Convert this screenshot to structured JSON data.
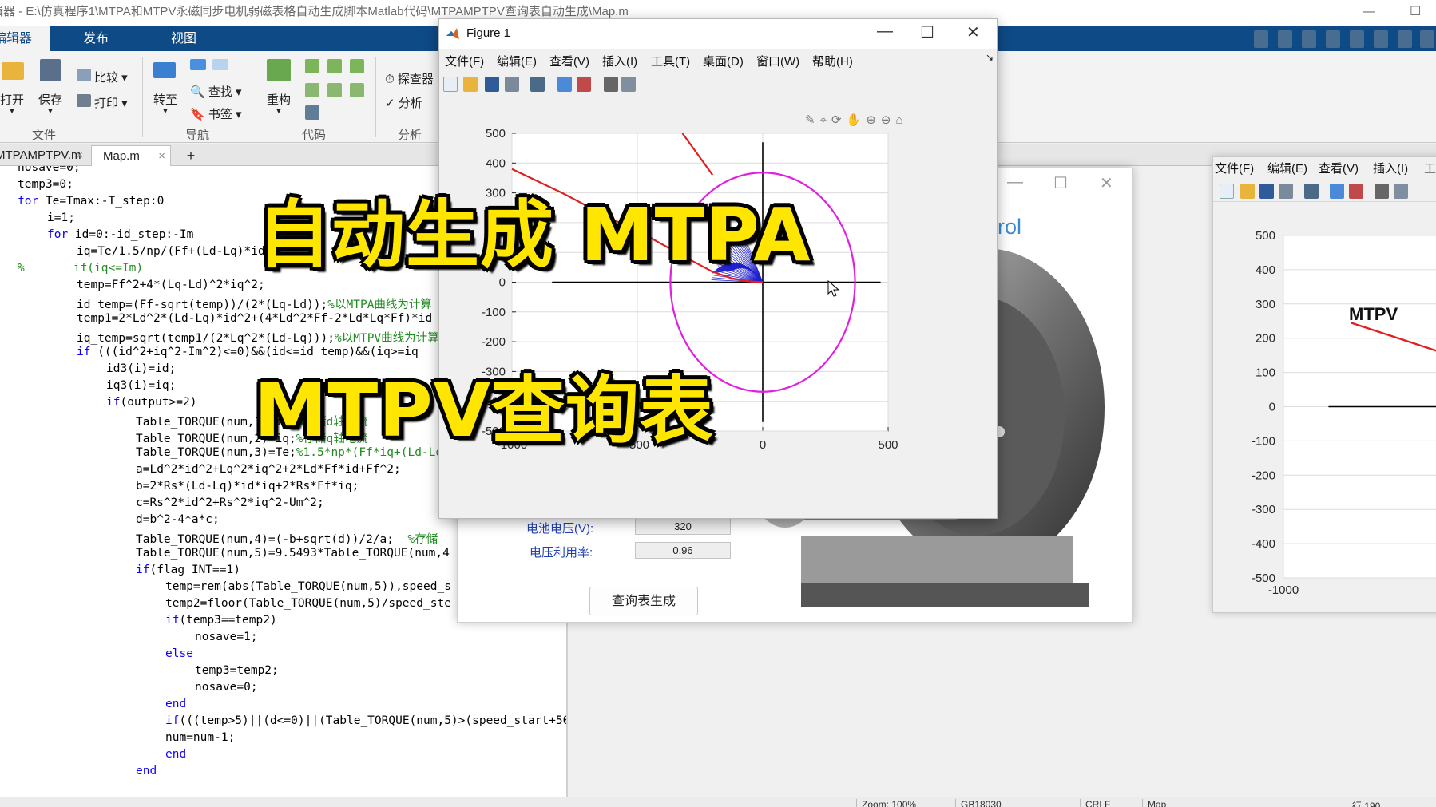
{
  "window_title": "编辑器 - E:\\仿真程序1\\MTPA和MTPV永磁同步电机弱磁表格自动生成脚本Matlab代码\\MTPAMPTPV查询表自动生成\\Map.m",
  "ribbon": {
    "tabs": [
      "编辑器",
      "发布",
      "视图"
    ],
    "file_group": {
      "open": "打开",
      "save": "保存",
      "label": "文件"
    },
    "nav_group": {
      "compare": "比较",
      "print": "打印",
      "goto": "转至",
      "find": "查找",
      "bookmark": "书签",
      "label": "导航"
    },
    "code_group": {
      "refactor": "重构",
      "label": "代码"
    },
    "analyze_group": {
      "explorer": "探查器",
      "analyze": "分析",
      "label": "分析"
    }
  },
  "editor_tabs": [
    "MTPAMPTPV.m",
    "Map.m"
  ],
  "add_tab": "+",
  "code_lines": [
    {
      "indent": 0,
      "parts": [
        {
          "t": "nosave=0;",
          "c": ""
        }
      ]
    },
    {
      "indent": 0,
      "parts": [
        {
          "t": "temp3=0;",
          "c": ""
        }
      ]
    },
    {
      "indent": 0,
      "parts": [
        {
          "t": "for",
          "c": "kw"
        },
        {
          "t": " Te=Tmax:-T_step:0",
          "c": ""
        }
      ]
    },
    {
      "indent": 1,
      "parts": [
        {
          "t": "i=1;",
          "c": ""
        }
      ]
    },
    {
      "indent": 1,
      "parts": [
        {
          "t": "for",
          "c": "kw"
        },
        {
          "t": " id=0:-id_step:-Im",
          "c": ""
        }
      ]
    },
    {
      "indent": 2,
      "parts": [
        {
          "t": "iq=Te/1.5/np/(Ff+(Ld-Lq)*id);",
          "c": ""
        }
      ]
    },
    {
      "indent": 0,
      "parts": [
        {
          "t": "%       if(iq<=Im)",
          "c": "cm"
        }
      ]
    },
    {
      "indent": 2,
      "parts": [
        {
          "t": "temp=Ff^2+4*(Lq-Ld)^2*iq^2;",
          "c": ""
        }
      ]
    },
    {
      "indent": 2,
      "parts": [
        {
          "t": "id_temp=(Ff-sqrt(temp))/(2*(Lq-Ld));",
          "c": ""
        },
        {
          "t": "%以MTPA曲线为计算",
          "c": "cm"
        }
      ]
    },
    {
      "indent": 2,
      "parts": [
        {
          "t": "temp1=2*Ld^2*(Ld-Lq)*id^2+(4*Ld^2*Ff-2*Ld*Lq*Ff)*id",
          "c": ""
        }
      ]
    },
    {
      "indent": 2,
      "parts": [
        {
          "t": "iq_temp=sqrt(temp1/(2*Lq^2*(Ld-Lq)));",
          "c": ""
        },
        {
          "t": "%以MTPV曲线为计算",
          "c": "cm"
        }
      ]
    },
    {
      "indent": 2,
      "parts": [
        {
          "t": "if",
          "c": "kw"
        },
        {
          "t": " (((id^2+iq^2-Im^2)<=0)&&(id<=id_temp)&&(iq>=iq",
          "c": ""
        }
      ]
    },
    {
      "indent": 3,
      "parts": [
        {
          "t": "id3(i)=id;",
          "c": ""
        }
      ]
    },
    {
      "indent": 3,
      "parts": [
        {
          "t": "iq3(i)=iq;",
          "c": ""
        }
      ]
    },
    {
      "indent": 3,
      "parts": [
        {
          "t": "if",
          "c": "kw"
        },
        {
          "t": "(output>=2)",
          "c": ""
        }
      ]
    },
    {
      "indent": 4,
      "parts": [
        {
          "t": "Table_TORQUE(num,1)=id;",
          "c": ""
        },
        {
          "t": "%存储d轴电流",
          "c": "cm"
        }
      ]
    },
    {
      "indent": 4,
      "parts": [
        {
          "t": "Table_TORQUE(num,2)=iq;",
          "c": ""
        },
        {
          "t": "%存储q轴电流",
          "c": "cm"
        }
      ]
    },
    {
      "indent": 4,
      "parts": [
        {
          "t": "Table_TORQUE(num,3)=Te;",
          "c": ""
        },
        {
          "t": "%1.5*np*(Ff*iq+(Ld-Lq",
          "c": "cm"
        }
      ]
    },
    {
      "indent": 4,
      "parts": [
        {
          "t": "a=Ld^2*id^2+Lq^2*iq^2+2*Ld*Ff*id+Ff^2;",
          "c": ""
        }
      ]
    },
    {
      "indent": 4,
      "parts": [
        {
          "t": "b=2*Rs*(Ld-Lq)*id*iq+2*Rs*Ff*iq;",
          "c": ""
        }
      ]
    },
    {
      "indent": 4,
      "parts": [
        {
          "t": "c=Rs^2*id^2+Rs^2*iq^2-Um^2;",
          "c": ""
        }
      ]
    },
    {
      "indent": 4,
      "parts": [
        {
          "t": "d=b^2-4*a*c;",
          "c": ""
        }
      ]
    },
    {
      "indent": 4,
      "parts": [
        {
          "t": "Table_TORQUE(num,4)=(-b+sqrt(d))/2/a;  ",
          "c": ""
        },
        {
          "t": "%存储",
          "c": "cm"
        }
      ]
    },
    {
      "indent": 4,
      "parts": [
        {
          "t": "Table_TORQUE(num,5)=9.5493*Table_TORQUE(num,4",
          "c": ""
        }
      ]
    },
    {
      "indent": 4,
      "parts": [
        {
          "t": "if",
          "c": "kw"
        },
        {
          "t": "(flag_INT==1)",
          "c": ""
        }
      ]
    },
    {
      "indent": 5,
      "parts": [
        {
          "t": "temp=rem(abs(Table_TORQUE(num,5)),speed_s",
          "c": ""
        }
      ]
    },
    {
      "indent": 5,
      "parts": [
        {
          "t": "temp2=floor(Table_TORQUE(num,5)/speed_ste",
          "c": ""
        }
      ]
    },
    {
      "indent": 5,
      "parts": [
        {
          "t": "if",
          "c": "kw"
        },
        {
          "t": "(temp3==temp2)",
          "c": ""
        }
      ]
    },
    {
      "indent": 6,
      "parts": [
        {
          "t": "nosave=1;",
          "c": ""
        }
      ]
    },
    {
      "indent": 5,
      "parts": [
        {
          "t": "else",
          "c": "kw"
        }
      ]
    },
    {
      "indent": 6,
      "parts": [
        {
          "t": "temp3=temp2;",
          "c": ""
        }
      ]
    },
    {
      "indent": 6,
      "parts": [
        {
          "t": "nosave=0;",
          "c": ""
        }
      ]
    },
    {
      "indent": 5,
      "parts": [
        {
          "t": "end",
          "c": "kw"
        }
      ]
    },
    {
      "indent": 5,
      "parts": [
        {
          "t": "if",
          "c": "kw"
        },
        {
          "t": "(((temp>5)||(d<=0)||(Table_TORQUE(num,5)>(speed_start+50))||(nosave==1))&&(num>=1))",
          "c": ""
        }
      ]
    },
    {
      "indent": 5,
      "parts": [
        {
          "t": "num=num-1;",
          "c": ""
        }
      ]
    },
    {
      "indent": 5,
      "parts": [
        {
          "t": "end",
          "c": "kw"
        }
      ]
    },
    {
      "indent": 4,
      "parts": [
        {
          "t": "end",
          "c": "kw"
        }
      ]
    }
  ],
  "status_bar": {
    "zoom": "Zoom: 100%",
    "encoding": "GB18030",
    "eol": "CRLF",
    "file": "Map",
    "position": "行 190"
  },
  "app_window": {
    "title_fragment": "rol",
    "labels": [
      {
        "text": "电池电压(V):",
        "value": "320"
      },
      {
        "text": "电压利用率:",
        "value": "0.96"
      }
    ],
    "button": "查询表生成"
  },
  "figure1": {
    "title": "Figure 1",
    "menus": [
      "文件(F)",
      "编辑(E)",
      "查看(V)",
      "插入(I)",
      "工具(T)",
      "桌面(D)",
      "窗口(W)",
      "帮助(H)"
    ]
  },
  "figure_right": {
    "menus": [
      "文件(F)",
      "编辑(E)",
      "查看(V)",
      "插入(I)",
      "工"
    ],
    "annotation": "MTPV"
  },
  "chart_data": [
    {
      "type": "line",
      "title": "",
      "xlabel": "",
      "ylabel": "",
      "xlim": [
        -1000,
        500
      ],
      "ylim": [
        -500,
        500
      ],
      "xticks": [
        -1000,
        -500,
        0,
        500
      ],
      "yticks": [
        500,
        400,
        300,
        200,
        100,
        0,
        -100,
        -200,
        -300,
        -400,
        -500
      ],
      "grid": true,
      "series": [
        {
          "kind": "current_limit_circle",
          "color": "#e020e0",
          "center": [
            0,
            0
          ],
          "radius": 368
        },
        {
          "kind": "mtpa_curve",
          "color": "#e02020",
          "x": [
            -1000,
            -800,
            -620,
            -450,
            -300,
            -200,
            -120,
            -60,
            0
          ],
          "y": [
            380,
            300,
            220,
            150,
            80,
            35,
            12,
            3,
            0
          ]
        },
        {
          "kind": "torque_fan",
          "color": "#1f1fd0",
          "lines": 20
        },
        {
          "kind": "mtpv_curve",
          "color": "#e02020",
          "x": [
            -320,
            -260,
            -200
          ],
          "y": [
            500,
            430,
            360
          ]
        }
      ]
    },
    {
      "type": "line",
      "title": "",
      "xlim": [
        -1000,
        -500
      ],
      "ylim": [
        -500,
        500
      ],
      "xticks": [
        -1000,
        -500
      ],
      "yticks": [
        500,
        400,
        300,
        200,
        100,
        0,
        -100,
        -200,
        -300,
        -400,
        -500
      ],
      "grid": true,
      "annotations": [
        "MTPV"
      ],
      "series": [
        {
          "kind": "mtpv_curve",
          "color": "#e02020",
          "x": [
            -820,
            -500
          ],
          "y": [
            245,
            130
          ]
        }
      ]
    }
  ],
  "overlay": {
    "line1": "自动生成 MTPA",
    "line2": "MTPV查询表"
  }
}
